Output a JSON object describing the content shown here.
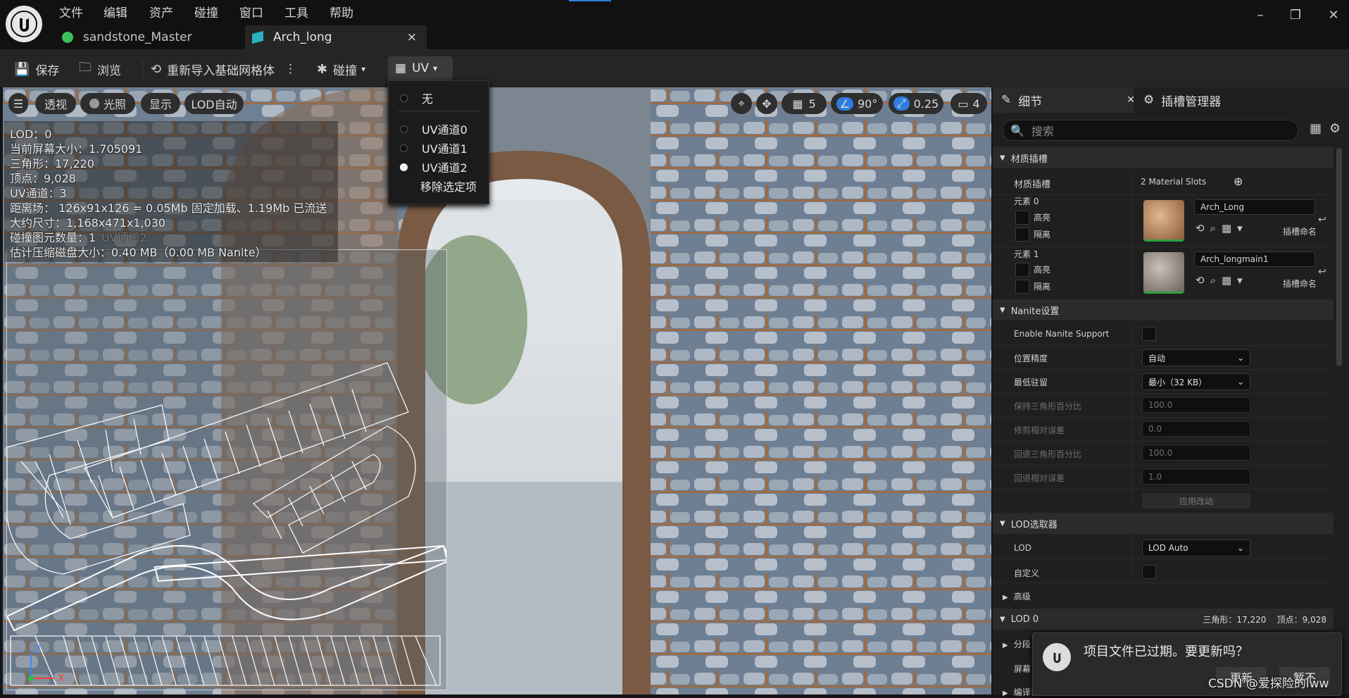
{
  "menu": [
    "文件",
    "编辑",
    "资产",
    "碰撞",
    "窗口",
    "工具",
    "帮助"
  ],
  "tabs": [
    {
      "label": "sandstone_Master"
    },
    {
      "label": "Arch_long",
      "close": "×"
    }
  ],
  "window": {
    "minimize": "–",
    "restore": "❐",
    "close": "✕"
  },
  "toolbar": {
    "save": "保存",
    "browse": "浏览",
    "reimport": "重新导入基础网格体",
    "collision": "碰撞",
    "uv": "UV"
  },
  "uv_menu": {
    "none": "无",
    "ch0": "UV通道0",
    "ch1": "UV通道1",
    "ch2": "UV通道2",
    "remove": "移除选定项",
    "selected": "UV通道2"
  },
  "viewport": {
    "perspective": "透视",
    "lighting": "光照",
    "show": "显示",
    "lod": "LOD自动",
    "grid_value": "5",
    "angle_value": "90°",
    "scale_value": "0.25",
    "camera_value": "4",
    "stats": [
      "LOD：0",
      "当前屏幕大小：1.705091",
      "三角形：17,220",
      "顶点：9,028",
      "UV通道：3",
      "距离场： 126x91x126 = 0.05Mb 固定加载、1.19Mb 已流送",
      "大约尺寸：1,168x471x1,030",
      "碰撞图元数量：1",
      "估计压缩磁盘大小：0.40 MB（0.00 MB Nanite）"
    ],
    "ghost": "UV通道2",
    "axis_z": "Z",
    "axis_x": "X"
  },
  "panel": {
    "details_tab": "细节",
    "socket_tab": "插槽管理器",
    "search_placeholder": "搜索",
    "material_section": "材质插槽",
    "material_slots_label": "材质插槽",
    "material_slots_value": "2 Material Slots",
    "element0": "元素 0",
    "element1": "元素 1",
    "highlight": "高亮",
    "isolate": "隔离",
    "mat0": "Arch_Long",
    "mat1": "Arch_longmain1",
    "slot_name": "插槽命名",
    "nanite_section": "Nanite设置",
    "enable_nanite": "Enable Nanite Support",
    "position_precision": "位置精度",
    "position_precision_value": "自动",
    "min_residency": "最低驻留",
    "min_residency_value": "最小（32 KB）",
    "keep_tri": "保持三角形百分比",
    "keep_tri_value": "100.0",
    "trim_err": "修剪相对误差",
    "trim_err_value": "0.0",
    "fallback_tri": "回退三角形百分比",
    "fallback_tri_value": "100.0",
    "fallback_err": "回退相对误差",
    "fallback_err_value": "1.0",
    "apply": "应用改动",
    "lod_picker_section": "LOD选取器",
    "lod_label": "LOD",
    "lod_value": "LOD Auto",
    "custom": "自定义",
    "advanced": "高级",
    "lod0_section": "LOD 0",
    "lod0_stats": "三角形：17,220    顶点：9,028",
    "section_label": "分段",
    "screen_label": "屏幕",
    "build_label": "编译设置"
  },
  "toast": {
    "message": "项目文件已过期。要更新吗？",
    "update": "更新",
    "later": "暂不"
  },
  "watermark": "CSDN @爱探险的lww",
  "colors": {
    "accent": "#2f7de1",
    "green": "#2ea043"
  }
}
